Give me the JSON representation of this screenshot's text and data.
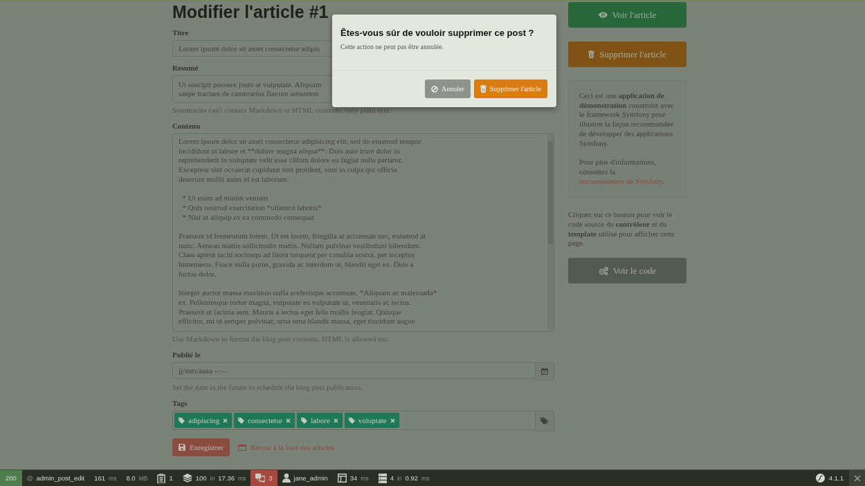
{
  "page_title": "Modifier l'article #1",
  "form": {
    "fields": [
      {
        "kind": "text",
        "label": "Titre",
        "value": "Lorem ipsum dolor sit amet consectetur adipis"
      },
      {
        "kind": "textarea",
        "label": "Résumé",
        "lines": [
          "Ut suscipit posuere justo at vulputate. Aliquam",
          "saepe tractare de camerarius flavum sensorem"
        ],
        "help": "Summaries can't contain Markdown or HTML contents; only plain text."
      },
      {
        "kind": "editor",
        "label": "Contenu",
        "value": "Lorem ipsum dolor sit amet consectetur adipisicing elit, sed do eiusmod tempor\nincididunt ut labore et **dolore magna aliqua**: Duis aute irure dolor in\nreprehenderit in voluptate velit esse cillum dolore eu fugiat nulla pariatur.\nExcepteur sint occaecat cupidatat non proident, sunt in culpa qui officia\ndeserunt mollit anim id est laborum.\n\n  * Ut enim ad minim veniam\n  * Quis nostrud exercitation *ullamco laboris*\n  * Nisi ut aliquip ex ea commodo consequat\n\nPraesent id fermentum lorem. Ut est lorem, fringilla at accumsan nec, euismod at\nnunc. Aenean mattis sollicitudin mattis. Nullam pulvinar vestibulum bibendum.\nClass aptent taciti sociosqu ad litora torquent per conubia nostra, per inceptos\nhimenaeos. Fusce nulla purus, gravida ac interdum ut, blandit eget ex. Duis a\nluctus dolor.\n\nInteger auctor massa maximus nulla scelerisque accumsan. *Aliquam ac malesuada*\nex. Pellentesque tortor magna, vulputate eu vulputate ut, venenatis ac lectus.\nPraesent ut lacinia sem. Mauris a lectus eget felis mollis feugiat. Quisque\nefficitur, mi ut semper pulvinar, urna urna blandit massa, eget tincidunt augue",
        "help": "Use Markdown to format the blog post contents. HTML is allowed too."
      },
      {
        "kind": "datetime",
        "label": "Publié le",
        "placeholder": "jj/mm/aaaa --:--",
        "help": "Set the date in the future to schedule the blog post publication."
      },
      {
        "kind": "tags",
        "label": "Tags",
        "tags": [
          "adipiscing",
          "consectetur",
          "labore",
          "voluptate"
        ]
      }
    ],
    "save_button": "Enregistrer",
    "back_link": "Retour à la liste des articles"
  },
  "sidebar": {
    "view_button": "Voir l'article",
    "delete_button": "Supprimer l'article",
    "info": "Ceci est une **application de démonstration** construite avec le framework Symfony pour illustrer la façon recommandée de développer des applications Symfony.",
    "more_text": "Pour plus d'informations, consultez la",
    "more_link": "documentation de Symfony",
    "more_end": ".",
    "code_note": "Cliquez sur ce bouton pour voir le code source du **contrôleur** et du **template** utilisé pour afficher cette page.",
    "code_button": "Voir le code"
  },
  "modal": {
    "title": "Êtes-vous sûr de vouloir supprimer ce post ?",
    "message": "Cette action ne peut pas être annulée.",
    "buttons": [
      {
        "kind": "cancel",
        "label": "Annuler"
      },
      {
        "kind": "confirm",
        "label": "Supprimer l'article"
      }
    ]
  },
  "debug_toolbar": {
    "items": [
      {
        "kind": "status",
        "color": "#4e7d50",
        "texts": [
          {
            "text": "200",
            "muted": false
          }
        ]
      },
      {
        "kind": "route",
        "texts": [
          {
            "text": "@",
            "muted": true
          },
          {
            "text": "admin_post_edit",
            "muted": false
          }
        ]
      },
      {
        "kind": "time",
        "texts": [
          {
            "text": "161",
            "muted": false
          },
          {
            "text": "ms",
            "muted": true
          }
        ]
      },
      {
        "kind": "memory",
        "texts": [
          {
            "text": "8.0",
            "muted": false
          },
          {
            "text": "MB",
            "muted": true
          }
        ]
      },
      {
        "kind": "forms",
        "texts": [
          {
            "text": "1",
            "muted": false
          }
        ]
      },
      {
        "kind": "cache",
        "texts": [
          {
            "text": "100",
            "muted": false
          },
          {
            "text": "in",
            "muted": true
          },
          {
            "text": "17.36",
            "muted": false
          },
          {
            "text": "ms",
            "muted": true
          }
        ]
      },
      {
        "kind": "translation",
        "color": "#a8493f",
        "texts": [
          {
            "text": "3",
            "muted": false
          }
        ]
      },
      {
        "kind": "user",
        "texts": [
          {
            "text": "jane_admin",
            "muted": false
          }
        ]
      },
      {
        "kind": "twig",
        "texts": [
          {
            "text": "34",
            "muted": false
          },
          {
            "text": "ms",
            "muted": true
          }
        ]
      },
      {
        "kind": "database",
        "texts": [
          {
            "text": "4",
            "muted": false
          },
          {
            "text": "in",
            "muted": true
          },
          {
            "text": "0.92",
            "muted": false
          },
          {
            "text": "ms",
            "muted": true
          }
        ]
      }
    ],
    "version": "4.1.1"
  }
}
